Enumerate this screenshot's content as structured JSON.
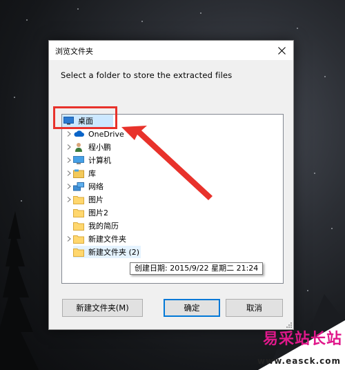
{
  "dialog": {
    "title": "浏览文件夹",
    "instruction": "Select a folder to store the extracted files"
  },
  "tree": {
    "items": [
      {
        "label": "桌面",
        "icon": "desktop-icon",
        "expandable": false,
        "selected": true
      },
      {
        "label": "OneDrive",
        "icon": "cloud-icon",
        "expandable": true
      },
      {
        "label": "程小鹏",
        "icon": "user-icon",
        "expandable": true
      },
      {
        "label": "计算机",
        "icon": "computer-icon",
        "expandable": true
      },
      {
        "label": "库",
        "icon": "library-icon",
        "expandable": true
      },
      {
        "label": "网络",
        "icon": "network-icon",
        "expandable": true
      },
      {
        "label": "图片",
        "icon": "folder-icon",
        "expandable": true
      },
      {
        "label": "图片2",
        "icon": "folder-icon",
        "expandable": false
      },
      {
        "label": "我的简历",
        "icon": "folder-icon",
        "expandable": false
      },
      {
        "label": "新建文件夹",
        "icon": "folder-icon",
        "expandable": true
      },
      {
        "label": "新建文件夹 (2)",
        "icon": "folder-icon",
        "expandable": false,
        "hovered": true
      }
    ]
  },
  "tooltip": {
    "text": "创建日期: 2015/9/22 星期二 21:24"
  },
  "buttons": {
    "new_folder": "新建文件夹(M)",
    "ok": "确定",
    "cancel": "取消"
  },
  "colors": {
    "annotation": "#e8322b",
    "selection": "#cce8ff",
    "watermark_text": "#e0188b"
  },
  "watermark": {
    "text_cn": "易采站长站",
    "url": "www.easck.com"
  }
}
